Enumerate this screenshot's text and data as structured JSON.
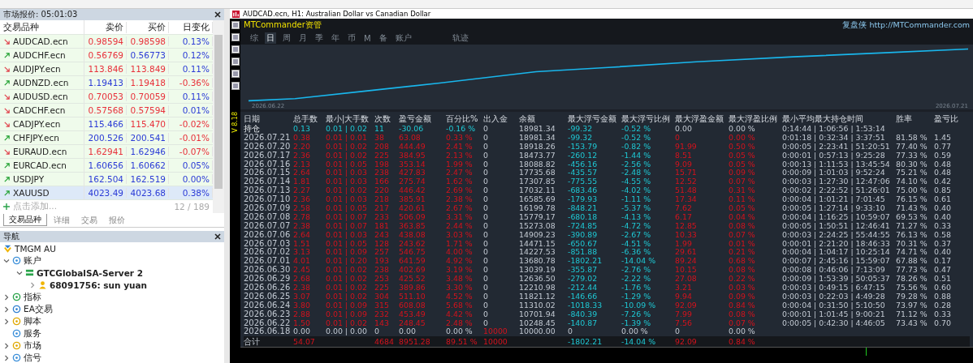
{
  "market_watch": {
    "title": "市场报价: 05:01:03",
    "columns": [
      "交易品种",
      "卖价",
      "买价",
      "日变化"
    ],
    "rows": [
      {
        "symbol": "AUDCAD.ecn",
        "up": false,
        "bid": "0.98594",
        "bid_up": false,
        "ask": "0.98598",
        "ask_up": false,
        "change": "0.13%",
        "change_up": true,
        "selected": false
      },
      {
        "symbol": "AUDCHF.ecn",
        "up": true,
        "bid": "0.56769",
        "bid_up": false,
        "ask": "0.56773",
        "ask_up": true,
        "change": "0.12%",
        "change_up": true,
        "selected": false
      },
      {
        "symbol": "AUDJPY.ecn",
        "up": false,
        "bid": "113.846",
        "bid_up": false,
        "ask": "113.849",
        "ask_up": false,
        "change": "0.11%",
        "change_up": true,
        "selected": false
      },
      {
        "symbol": "AUDNZD.ecn",
        "up": true,
        "bid": "1.19413",
        "bid_up": true,
        "ask": "1.19418",
        "ask_up": false,
        "change": "-0.36%",
        "change_up": false,
        "selected": false
      },
      {
        "symbol": "AUDUSD.ecn",
        "up": false,
        "bid": "0.70053",
        "bid_up": false,
        "ask": "0.70059",
        "ask_up": false,
        "change": "0.11%",
        "change_up": true,
        "selected": false
      },
      {
        "symbol": "CADCHF.ecn",
        "up": false,
        "bid": "0.57568",
        "bid_up": false,
        "ask": "0.57594",
        "ask_up": false,
        "change": "0.01%",
        "change_up": true,
        "selected": false
      },
      {
        "symbol": "CADJPY.ecn",
        "up": false,
        "bid": "115.466",
        "bid_up": true,
        "ask": "115.470",
        "ask_up": false,
        "change": "-0.02%",
        "change_up": false,
        "selected": false
      },
      {
        "symbol": "CHFJPY.ecn",
        "up": true,
        "bid": "200.526",
        "bid_up": true,
        "ask": "200.541",
        "ask_up": true,
        "change": "-0.01%",
        "change_up": false,
        "selected": false
      },
      {
        "symbol": "EURAUD.ecn",
        "up": false,
        "bid": "1.62941",
        "bid_up": false,
        "ask": "1.62946",
        "ask_up": true,
        "change": "-0.07%",
        "change_up": false,
        "selected": false
      },
      {
        "symbol": "EURCAD.ecn",
        "up": true,
        "bid": "1.60656",
        "bid_up": true,
        "ask": "1.60662",
        "ask_up": true,
        "change": "0.05%",
        "change_up": true,
        "selected": false
      },
      {
        "symbol": "USDJPY",
        "up": true,
        "bid": "162.504",
        "bid_up": true,
        "ask": "162.519",
        "ask_up": true,
        "change": "0.00%",
        "change_up": true,
        "selected": false
      },
      {
        "symbol": "XAUUSD",
        "up": true,
        "bid": "4023.49",
        "bid_up": true,
        "ask": "4023.68",
        "ask_up": true,
        "change": "0.38%",
        "change_up": true,
        "selected": true
      }
    ],
    "add_link": "点击添加...",
    "count": "12 / 189",
    "tabs": [
      {
        "label": "交易品种",
        "selected": true
      },
      {
        "label": "详细",
        "selected": false
      },
      {
        "label": "交易",
        "selected": false
      },
      {
        "label": "报价",
        "selected": false
      }
    ]
  },
  "navigator": {
    "title": "导航",
    "tree": [
      {
        "label": "TMGM AU",
        "children": [
          {
            "label": "账户",
            "expanded": true,
            "children": [
              {
                "label": "GTCGlobalSA-Server 2",
                "expanded": true,
                "children": [
                  {
                    "label": "68091756: sun yuan",
                    "expanded": false
                  }
                ]
              }
            ]
          },
          {
            "label": "指标",
            "expanded": false
          },
          {
            "label": "EA交易",
            "expanded": false
          },
          {
            "label": "脚本",
            "expanded": false
          },
          {
            "label": "服务"
          },
          {
            "label": "市场",
            "expanded": false
          },
          {
            "label": "信号",
            "expanded": false
          }
        ]
      }
    ]
  },
  "chart_window": {
    "title": "AUDCAD.ecn, H1:  Australian Dollar vs Canadian Dollar",
    "brand": "MTCommander资管",
    "site": "复盘侠 http://MTCommander.com",
    "tabs": [
      {
        "label": "综",
        "selected": false
      },
      {
        "label": "日",
        "selected": true
      },
      {
        "label": "周",
        "selected": false
      },
      {
        "label": "月",
        "selected": false
      },
      {
        "label": "季",
        "selected": false
      },
      {
        "label": "年",
        "selected": false
      },
      {
        "label": "币",
        "selected": false
      },
      {
        "label": "M",
        "selected": false
      },
      {
        "label": "备",
        "selected": false
      },
      {
        "label": "账户",
        "selected": false
      },
      {
        "label": "轨迹",
        "selected": false
      }
    ],
    "start_date": "2026.06.22",
    "end_date": "2026.07.21",
    "version": "V 8.18",
    "table": {
      "columns": [
        "日期",
        "总手数",
        "最小|大手数",
        "次数",
        "盈亏金额",
        "百分比%",
        "出入金",
        "余额",
        "最大浮亏金额",
        "最大浮亏比例",
        "最大浮盈金额",
        "最大浮盈比例",
        "最小平均最大持仓时间",
        "胜率",
        "盈亏比"
      ],
      "rows": [
        {
          "kind": "open",
          "cells": [
            "持仓",
            "0.13",
            "0.01 | 0.02",
            "11",
            "-30.06",
            "-0.16 %",
            "0",
            "18981.34",
            "-99.32",
            "-0.52 %",
            "0.00",
            "0.00 %",
            "0:14:44 | 1:06:56 | 1:53:14",
            null,
            null
          ]
        },
        {
          "kind": "day",
          "cells": [
            "2026.07.21",
            "0.38",
            "0.01 | 0.01",
            "38",
            "63.08",
            "0.33 %",
            "0",
            "18981.34",
            "-99.32",
            "-0.52 %",
            "0",
            "0.00 %",
            "0:01:18 | 0:32:34 | 3:37:51",
            "81.58 %",
            "1.45"
          ]
        },
        {
          "kind": "day",
          "cells": [
            "2026.07.20",
            "2.20",
            "0.01 | 0.02",
            "208",
            "444.49",
            "2.41 %",
            "0",
            "18918.26",
            "-153.79",
            "-0.82 %",
            "91.99",
            "0.50 %",
            "0:00:05 | 2:23:41 | 51:20:51",
            "77.40 %",
            "0.77"
          ]
        },
        {
          "kind": "day",
          "cells": [
            "2026.07.17",
            "2.36",
            "0.01 | 0.02",
            "225",
            "384.95",
            "2.13 %",
            "0",
            "18473.77",
            "-260.12",
            "-1.44 %",
            "8.51",
            "0.05 %",
            "0:00:01 | 0:57:13 | 9:25:28",
            "77.33 %",
            "0.59"
          ]
        },
        {
          "kind": "day",
          "cells": [
            "2026.07.16",
            "2.13",
            "0.01 | 0.05",
            "198",
            "353.14",
            "1.99 %",
            "0",
            "18088.82",
            "-456.16",
            "-2.56 %",
            "9.09",
            "0.05 %",
            "0:00:13 | 1:11:53 | 13:45:54",
            "80.30 %",
            "0.48"
          ]
        },
        {
          "kind": "day",
          "cells": [
            "2026.07.15",
            "2.64",
            "0.01 | 0.03",
            "238",
            "427.83",
            "2.47 %",
            "0",
            "17735.68",
            "-435.57",
            "-2.48 %",
            "15.71",
            "0.09 %",
            "0:00:09 | 1:01:03 | 9:52:24",
            "75.21 %",
            "0.48"
          ]
        },
        {
          "kind": "day",
          "cells": [
            "2026.07.14",
            "1.81",
            "0.01 | 0.03",
            "166",
            "275.74",
            "1.62 %",
            "0",
            "17307.85",
            "-775.55",
            "-4.55 %",
            "12.52",
            "0.07 %",
            "0:00:03 | 1:27:30 | 12:47:06",
            "74.10 %",
            "0.42"
          ]
        },
        {
          "kind": "day",
          "cells": [
            "2026.07.13",
            "2.27",
            "0.01 | 0.02",
            "220",
            "446.42",
            "2.69 %",
            "0",
            "17032.11",
            "-683.46",
            "-4.02 %",
            "51.48",
            "0.31 %",
            "0:00:02 | 2:22:52 | 51:26:01",
            "75.00 %",
            "0.85"
          ]
        },
        {
          "kind": "day",
          "cells": [
            "2026.07.10",
            "2.36",
            "0.01 | 0.03",
            "218",
            "385.91",
            "2.38 %",
            "0",
            "16585.69",
            "-179.93",
            "-1.11 %",
            "17.34",
            "0.11 %",
            "0:00:04 | 1:01:21 | 7:01:45",
            "76.15 %",
            "0.61"
          ]
        },
        {
          "kind": "day",
          "cells": [
            "2026.07.09",
            "2.58",
            "0.01 | 0.05",
            "217",
            "420.61",
            "2.67 %",
            "0",
            "16199.78",
            "-848.21",
            "-5.37 %",
            "7.62",
            "0.05 %",
            "0:00:05 | 1:27:14 | 9:33:10",
            "71.43 %",
            "0.40"
          ]
        },
        {
          "kind": "day",
          "cells": [
            "2026.07.08",
            "2.78",
            "0.01 | 0.07",
            "233",
            "506.09",
            "3.31 %",
            "0",
            "15779.17",
            "-680.18",
            "-4.13 %",
            "6.17",
            "0.04 %",
            "0:00:04 | 1:16:25 | 10:59:07",
            "69.53 %",
            "0.40"
          ]
        },
        {
          "kind": "day",
          "cells": [
            "2026.07.07",
            "2.38",
            "0.01 | 0.07",
            "181",
            "363.85",
            "2.44 %",
            "0",
            "15273.08",
            "-724.85",
            "-4.72 %",
            "12.85",
            "0.08 %",
            "0:00:05 | 1:50:51 | 12:46:41",
            "71.27 %",
            "0.33"
          ]
        },
        {
          "kind": "day",
          "cells": [
            "2026.07.06",
            "2.64",
            "0.01 | 0.03",
            "243",
            "438.08",
            "3.03 %",
            "0",
            "14909.23",
            "-390.89",
            "-2.67 %",
            "10.33",
            "0.07 %",
            "0:00:03 | 2:24:25 | 55:44:55",
            "76.13 %",
            "0.58"
          ]
        },
        {
          "kind": "day",
          "cells": [
            "2026.07.03",
            "1.51",
            "0.01 | 0.05",
            "128",
            "243.62",
            "1.71 %",
            "0",
            "14471.15",
            "-650.67",
            "-4.51 %",
            "1.99",
            "0.01 %",
            "0:00:01 | 2:21:20 | 18:46:33",
            "70.31 %",
            "0.37"
          ]
        },
        {
          "kind": "day",
          "cells": [
            "2026.07.02",
            "3.13",
            "0.01 | 0.09",
            "257",
            "546.75",
            "4.00 %",
            "0",
            "14227.53",
            "-851.88",
            "-6.36 %",
            "29.61",
            "0.21 %",
            "0:00:04 | 1:04:17 | 10:25:14",
            "74.71 %",
            "0.40"
          ]
        },
        {
          "kind": "day",
          "cells": [
            "2026.07.01",
            "4.01",
            "0.01 | 0.20",
            "193",
            "641.59",
            "4.92 %",
            "0",
            "13680.78",
            "-1802.21",
            "-14.04 %",
            "89.24",
            "0.68 %",
            "0:00:07 | 2:45:16 | 15:59:07",
            "67.88 %",
            "0.17"
          ]
        },
        {
          "kind": "day",
          "cells": [
            "2026.06.30",
            "2.45",
            "0.01 | 0.02",
            "238",
            "402.69",
            "3.19 %",
            "0",
            "13039.19",
            "-355.87",
            "-2.76 %",
            "10.15",
            "0.08 %",
            "0:00:08 | 0:46:06 | 7:13:09",
            "77.73 %",
            "0.47"
          ]
        },
        {
          "kind": "day",
          "cells": [
            "2026.06.29",
            "2.68",
            "0.01 | 0.02",
            "253",
            "425.52",
            "3.48 %",
            "0",
            "12636.50",
            "-279.02",
            "-2.22 %",
            "27.08",
            "0.22 %",
            "0:00:09 | 1:53:39 | 50:05:37",
            "78.26 %",
            "0.51"
          ]
        },
        {
          "kind": "day",
          "cells": [
            "2026.06.26",
            "2.38",
            "0.01 | 0.02",
            "225",
            "389.86",
            "3.30 %",
            "0",
            "12210.98",
            "-212.44",
            "-1.76 %",
            "3.21",
            "0.03 %",
            "0:00:03 | 0:49:15 | 6:47:15",
            "75.56 %",
            "0.60"
          ]
        },
        {
          "kind": "day",
          "cells": [
            "2026.06.25",
            "3.07",
            "0.01 | 0.02",
            "304",
            "511.10",
            "4.52 %",
            "0",
            "11821.12",
            "-146.66",
            "-1.29 %",
            "9.94",
            "0.09 %",
            "0:00:03 | 0:22:03 | 4:49:28",
            "79.28 %",
            "0.88"
          ]
        },
        {
          "kind": "day",
          "cells": [
            "2026.06.24",
            "3.80",
            "0.01 | 0.09",
            "315",
            "608.08",
            "5.68 %",
            "0",
            "11310.02",
            "-1018.33",
            "-10.09 %",
            "92.09",
            "0.84 %",
            "0:00:04 | 0:31:50 | 5:10:50",
            "73.97 %",
            "0.28"
          ]
        },
        {
          "kind": "day",
          "cells": [
            "2026.06.23",
            "2.88",
            "0.01 | 0.09",
            "232",
            "453.49",
            "4.42 %",
            "0",
            "10701.94",
            "-840.39",
            "-7.26 %",
            "7.99",
            "0.08 %",
            "0:00:01 | 1:01:45 | 9:00:21",
            "71.12 %",
            "0.33"
          ]
        },
        {
          "kind": "day",
          "cells": [
            "2026.06.22",
            "1.50",
            "0.01 | 0.02",
            "143",
            "248.45",
            "2.48 %",
            "0",
            "10248.45",
            "-140.87",
            "-1.39 %",
            "7.56",
            "0.07 %",
            "0:00:05 | 0:42:30 | 4:46:05",
            "73.43 %",
            "0.70"
          ]
        },
        {
          "kind": "deposit",
          "cells": [
            "2026.06.18",
            "0.00",
            "0.00 | 0.00",
            "0",
            "0.00",
            "0.00 %",
            "10000",
            "10000.00",
            "0",
            "0.00 %",
            "0",
            "0.00 %",
            null,
            null,
            null
          ]
        },
        {
          "kind": "total",
          "cells": [
            "合计",
            "54.07",
            null,
            "4684",
            "8951.28",
            "89.51 %",
            "10000",
            null,
            "-1802.21",
            "-14.04 %",
            "92.09",
            "0.84 %",
            null,
            null,
            null
          ]
        }
      ]
    }
  }
}
